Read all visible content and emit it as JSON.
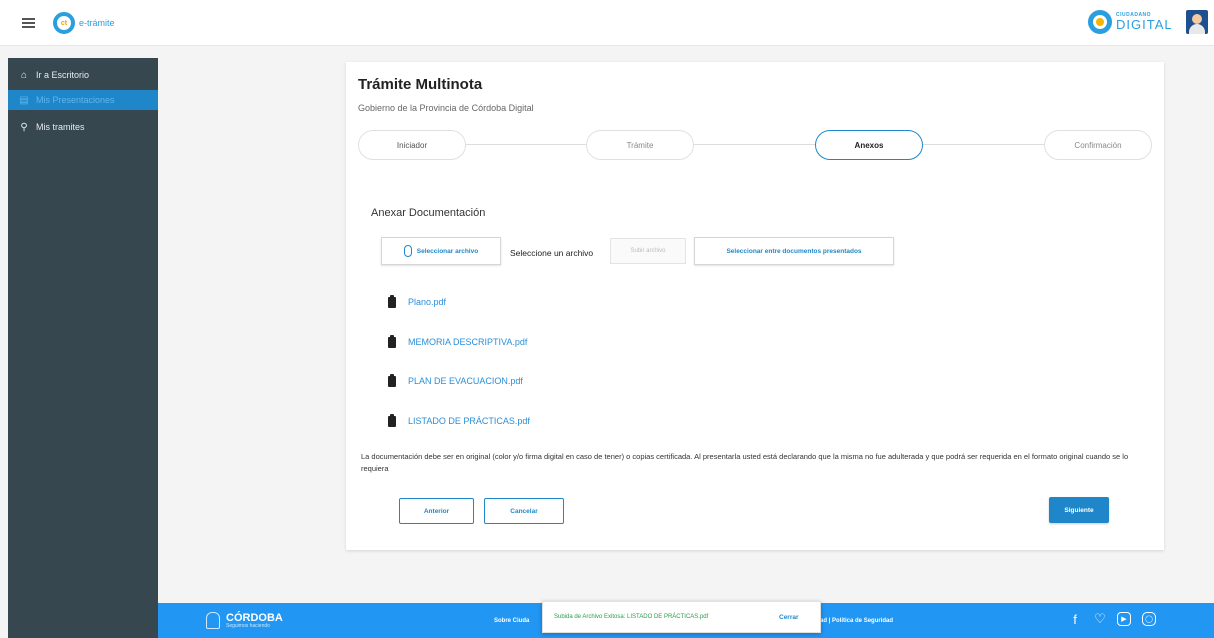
{
  "header": {
    "app_logo_text": "e-trámite",
    "app_logo_glyph": "ct",
    "brand_small": "CIUDADANO",
    "brand_big": "DIGITAL"
  },
  "sidebar": {
    "items": [
      {
        "label": "Ir a Escritorio",
        "icon": "home-icon"
      },
      {
        "label": "Mis Presentaciones",
        "icon": "document-icon",
        "active": true
      },
      {
        "label": "Mis tramites",
        "icon": "search-icon"
      }
    ]
  },
  "card": {
    "title": "Trámite Multinota",
    "subtitle": "Gobierno de la Provincia de Córdoba Digital",
    "steps": [
      "Iniciador",
      "Trámite",
      "Anexos",
      "Confirmación"
    ],
    "active_step": 2,
    "section_title": "Anexar Documentación",
    "select_file_button": "Seleccionar archivo",
    "select_file_label": "Seleccione un archivo",
    "upload_button": "Subir archivo",
    "select_presented_button": "Seleccionar entre documentos presentados",
    "files": [
      "Plano.pdf",
      "MEMORIA DESCRIPTIVA.pdf",
      "PLAN DE EVACUACION.pdf",
      "LISTADO DE PRÁCTICAS.pdf"
    ],
    "notice": "La documentación debe ser en original (color y/o firma digital en caso de tener) o copias certificada. Al presentarla usted está declarando que la misma no fue adulterada y que podrá ser requerida en el formato original cuando se lo requiera",
    "back_button": "Anterior",
    "cancel_button": "Cancelar",
    "next_button": "Siguiente"
  },
  "footer": {
    "logo_big": "CÓRDOBA",
    "logo_small": "Seguimos haciendo",
    "left_link": "Sobre Ciuda",
    "right_link": "ad | Política de Seguridad",
    "social_icons": [
      "facebook-icon",
      "twitter-icon",
      "youtube-icon",
      "instagram-icon"
    ]
  },
  "snackbar": {
    "message": "Subida de Archivo Exitosa: LISTADO DE PRÁCTICAS.pdf",
    "close_label": "Cerrar",
    "message_color": "#2a9d4a"
  },
  "colors": {
    "accent": "#1f87c9",
    "sidebar_bg": "#37474f",
    "footer_bg": "#2196f3"
  }
}
